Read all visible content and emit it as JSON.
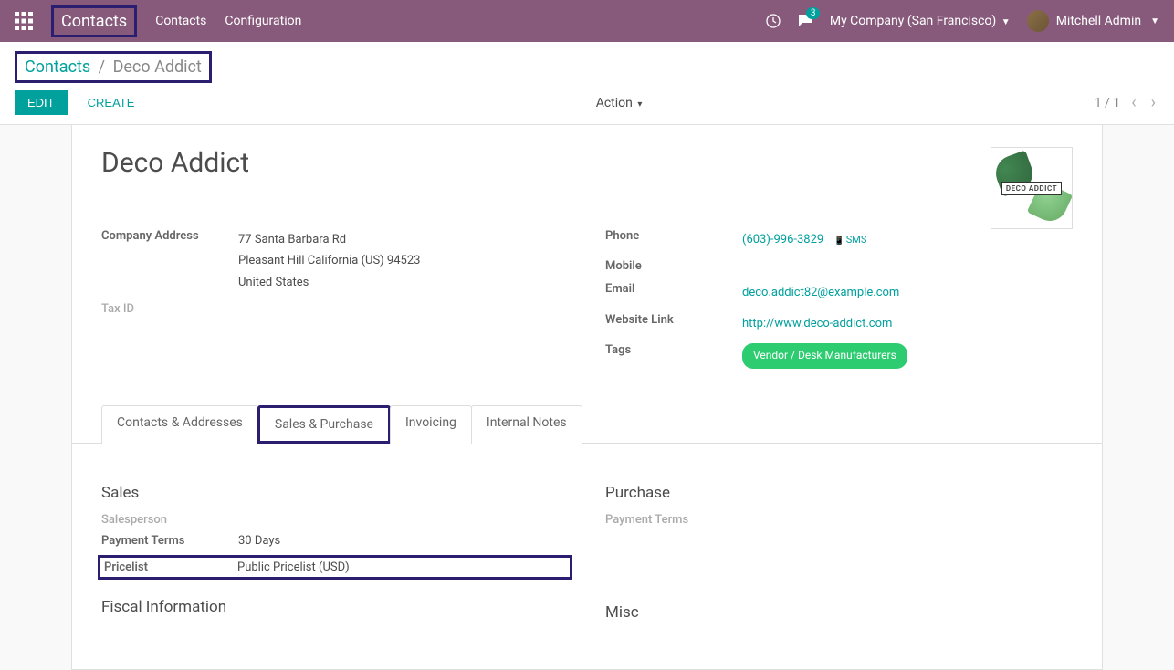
{
  "navbar": {
    "brand": "Contacts",
    "links": [
      "Contacts",
      "Configuration"
    ],
    "messages_badge": "3",
    "company": "My Company (San Francisco)",
    "user": "Mitchell Admin"
  },
  "breadcrumb": {
    "root": "Contacts",
    "current": "Deco Addict"
  },
  "buttons": {
    "edit": "EDIT",
    "create": "CREATE",
    "action": "Action"
  },
  "pager": {
    "text": "1 / 1"
  },
  "record": {
    "title": "Deco Addict",
    "logo_text": "DECO ADDICT",
    "left_fields": {
      "address_label": "Company Address",
      "address_line1": "77 Santa Barbara Rd",
      "address_line2": "Pleasant Hill  California (US)  94523",
      "address_line3": "United States",
      "tax_id_label": "Tax ID"
    },
    "right_fields": {
      "phone_label": "Phone",
      "phone_value": "(603)-996-3829",
      "sms": "SMS",
      "mobile_label": "Mobile",
      "email_label": "Email",
      "email_value": "deco.addict82@example.com",
      "website_label": "Website Link",
      "website_value": "http://www.deco-addict.com",
      "tags_label": "Tags",
      "tags_value": "Vendor / Desk Manufacturers"
    }
  },
  "tabs": [
    "Contacts & Addresses",
    "Sales & Purchase",
    "Invoicing",
    "Internal Notes"
  ],
  "sales": {
    "title": "Sales",
    "salesperson_label": "Salesperson",
    "payment_terms_label": "Payment Terms",
    "payment_terms_value": "30 Days",
    "pricelist_label": "Pricelist",
    "pricelist_value": "Public Pricelist (USD)"
  },
  "purchase": {
    "title": "Purchase",
    "payment_terms_label": "Payment Terms"
  },
  "fiscal": {
    "title": "Fiscal Information"
  },
  "misc": {
    "title": "Misc"
  }
}
